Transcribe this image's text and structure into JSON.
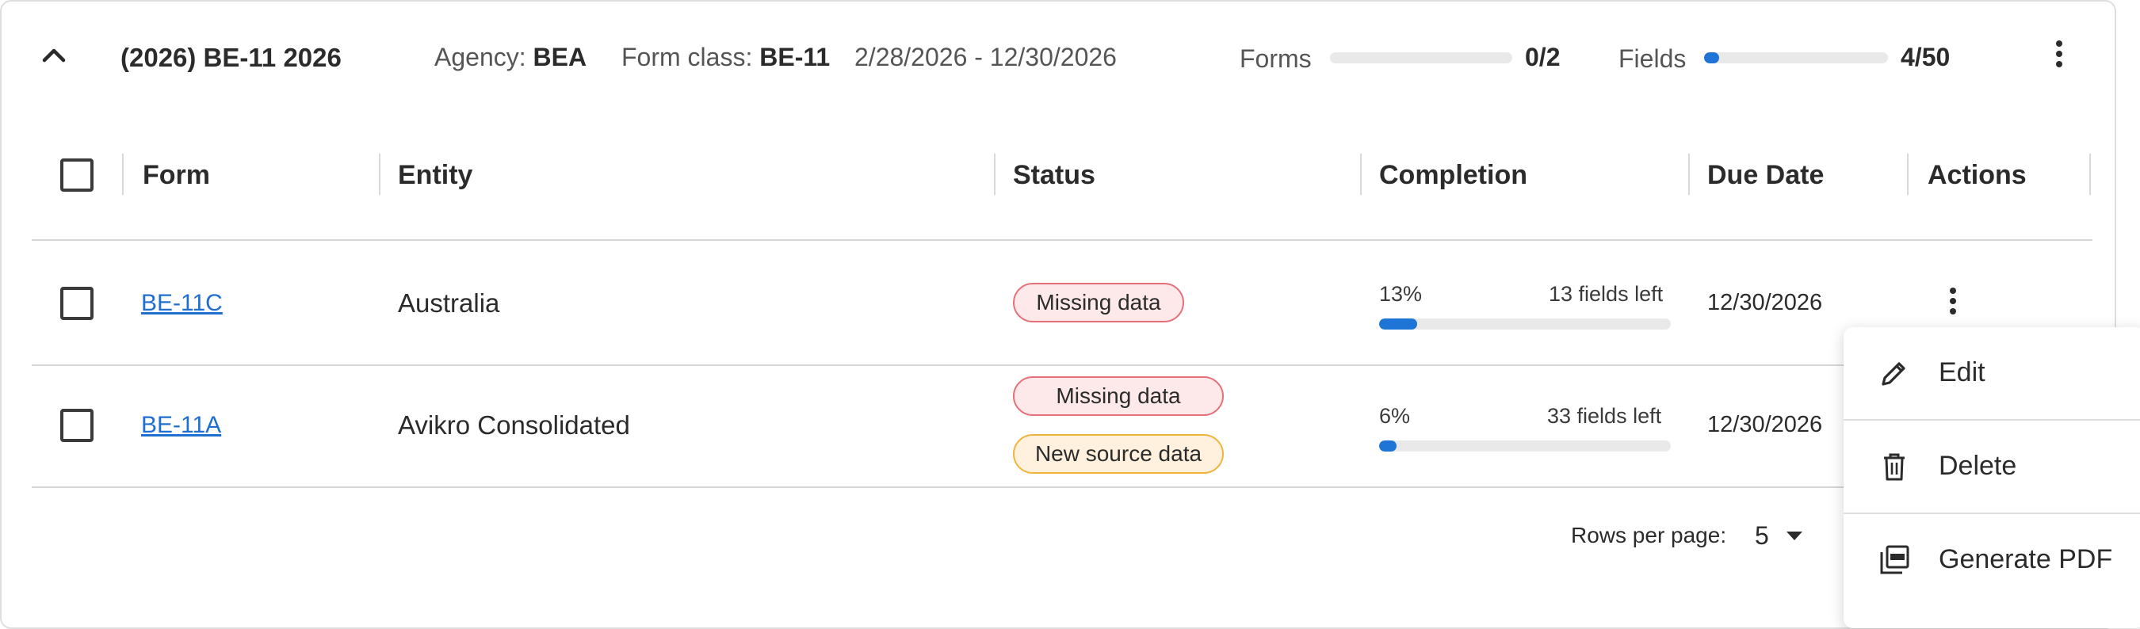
{
  "header": {
    "title": "(2026) BE-11 2026",
    "agency_label": "Agency:",
    "agency_value": "BEA",
    "form_class_label": "Form class:",
    "form_class_value": "BE-11",
    "date_range": "2/28/2026 - 12/30/2026",
    "forms_label": "Forms",
    "forms_count": "0/2",
    "forms_progress": 0,
    "fields_label": "Fields",
    "fields_count": "4/50",
    "fields_progress": 0.08
  },
  "table": {
    "columns": [
      "Form",
      "Entity",
      "Status",
      "Completion",
      "Due Date",
      "Actions"
    ],
    "rows": [
      {
        "form": "BE-11C",
        "entity": "Australia",
        "statuses": [
          "Missing data"
        ],
        "completion_pct": "13%",
        "completion_value": 0.13,
        "fields_left": "13 fields left",
        "due_date": "12/30/2026"
      },
      {
        "form": "BE-11A",
        "entity": "Avikro Consolidated",
        "statuses": [
          "Missing data",
          "New source data"
        ],
        "completion_pct": "6%",
        "completion_value": 0.06,
        "fields_left": "33 fields left",
        "due_date": "12/30/2026"
      }
    ]
  },
  "pagination": {
    "rows_per_page_label": "Rows per page:",
    "rows_per_page_value": "5"
  },
  "menu": {
    "items": [
      {
        "label": "Edit",
        "icon": "pencil-icon"
      },
      {
        "label": "Delete",
        "icon": "trash-icon"
      },
      {
        "label": "Generate PDF",
        "icon": "pdf-icon"
      }
    ]
  },
  "colors": {
    "accent": "#1f75d6",
    "missing_bg": "#fde8ea",
    "missing_border": "#e6707a",
    "new_bg": "#fff1dd",
    "new_border": "#f0b43c"
  }
}
